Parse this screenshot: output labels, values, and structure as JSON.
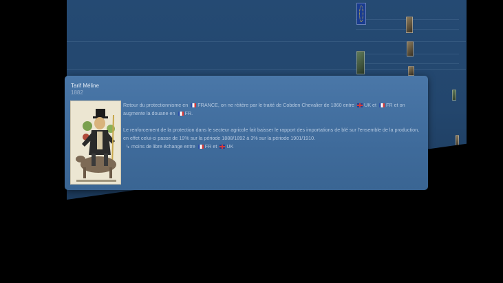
{
  "popup": {
    "title": "Tarif Méline",
    "date": "1882",
    "paragraph1": {
      "t1": "Retour du protectionnisme en",
      "country1": "FRANCE",
      "t2": ", on ne réitère par le traité de Cobden Chevalier de 1860 entre",
      "country2": "UK",
      "t3": "et",
      "country3": "FR",
      "t4": "et on augmente la douane en",
      "country4": "FR",
      "t5": "."
    },
    "paragraph2": {
      "text": "Le renforcement de la protection dans le secteur agricole fait baisser le rapport des importations de blé sur l'ensemble de la production, en effet celui-ci passe de 19% sur la période 1888/1892 à 3% sur la période 1901/1910.",
      "arrow": "↳",
      "t1": "moins de libre échange entre",
      "country1": "FR",
      "t2": "et",
      "country2": "UK"
    },
    "image_icon": "caricature-illustration"
  },
  "colors": {
    "background": "#000000",
    "timeline_plane": "#254a73",
    "popup": "#4a77a8"
  }
}
